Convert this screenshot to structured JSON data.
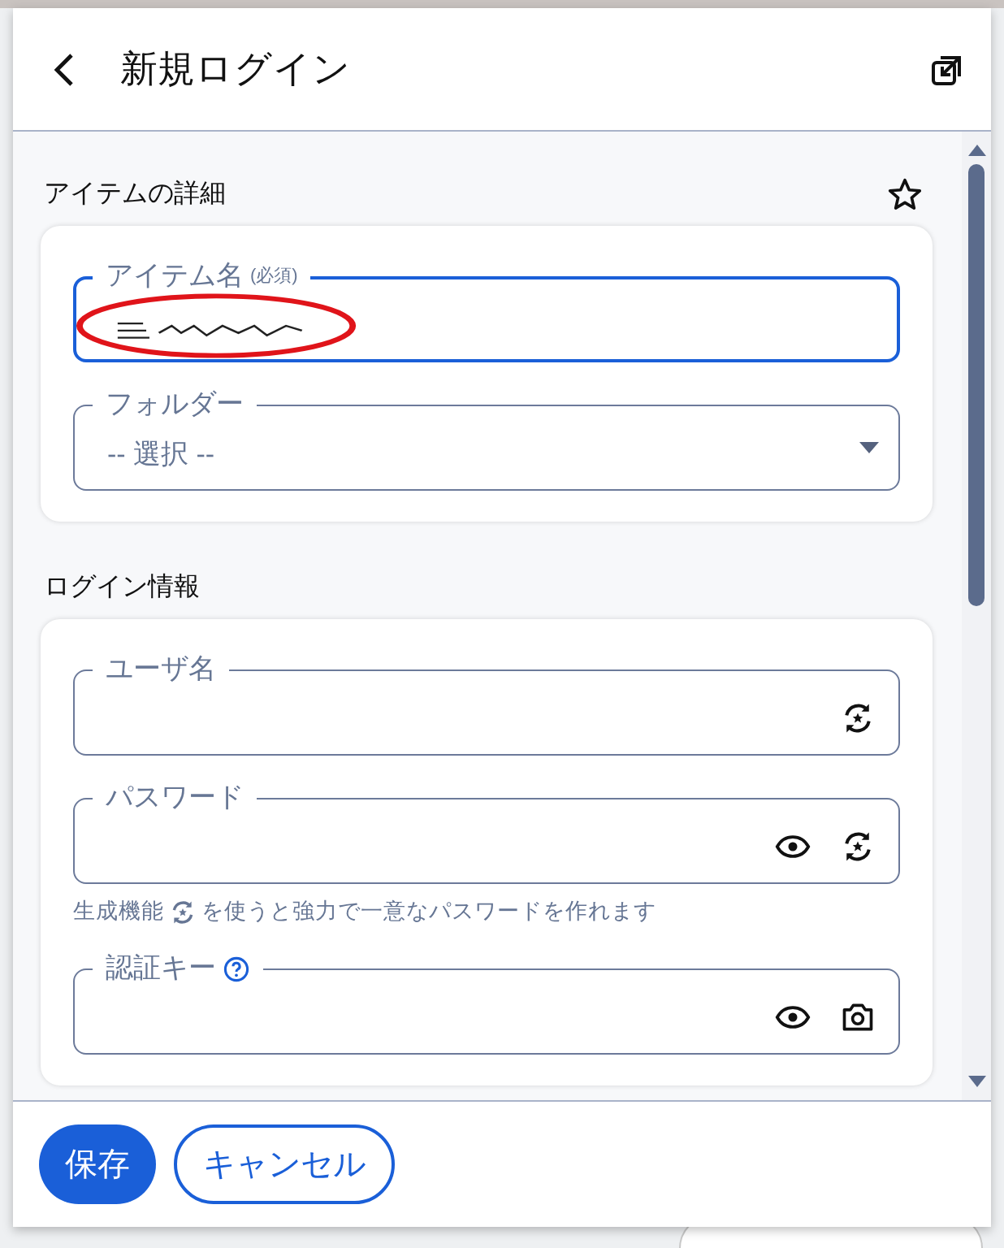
{
  "header": {
    "title": "新規ログイン"
  },
  "sections": [
    {
      "title": "アイテムの詳細",
      "favorite": false,
      "fields": [
        {
          "kind": "text",
          "label": "アイテム名",
          "required_note": "(必須)",
          "focused": true,
          "redacted": true
        },
        {
          "kind": "select",
          "label": "フォルダー",
          "value": "-- 選択 --"
        }
      ]
    },
    {
      "title": "ログイン情報",
      "fields": [
        {
          "kind": "text",
          "label": "ユーザ名",
          "actions": [
            {
              "kind": "generate"
            }
          ]
        },
        {
          "kind": "text",
          "label": "パスワード",
          "actions": [
            {
              "kind": "reveal"
            },
            {
              "kind": "generate"
            }
          ],
          "hint_before": "生成機能",
          "hint_after": "を使うと強力で一意なパスワードを作れます"
        },
        {
          "kind": "text",
          "label": "認証キー",
          "help": true,
          "actions": [
            {
              "kind": "reveal"
            },
            {
              "kind": "camera"
            }
          ]
        }
      ]
    }
  ],
  "buttons": [
    {
      "label": "保存",
      "kind": "primary"
    },
    {
      "label": "キャンセル",
      "kind": "secondary"
    }
  ]
}
